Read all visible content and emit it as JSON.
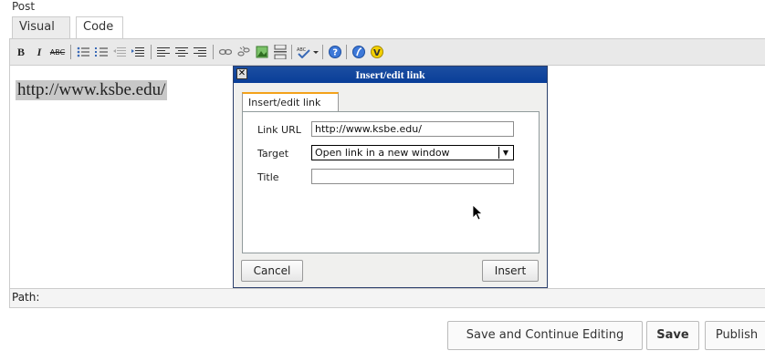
{
  "post_label": "Post",
  "tabs": [
    {
      "label": "Visual"
    },
    {
      "label": "Code"
    }
  ],
  "toolbar": {
    "bold": "B",
    "italic": "I",
    "strike": "ABC"
  },
  "content": {
    "link_text": "http://www.ksbe.edu/"
  },
  "path_label": "Path:",
  "dialog": {
    "title": "Insert/edit link",
    "tab": "Insert/edit link",
    "link_url_label": "Link URL",
    "link_url_value": "http://www.ksbe.edu/",
    "target_label": "Target",
    "target_value": "Open link in a new window",
    "title_label": "Title",
    "title_value": "",
    "cancel": "Cancel",
    "insert": "Insert"
  },
  "actions": {
    "save_continue": "Save and Continue Editing",
    "save": "Save",
    "publish": "Publish"
  }
}
